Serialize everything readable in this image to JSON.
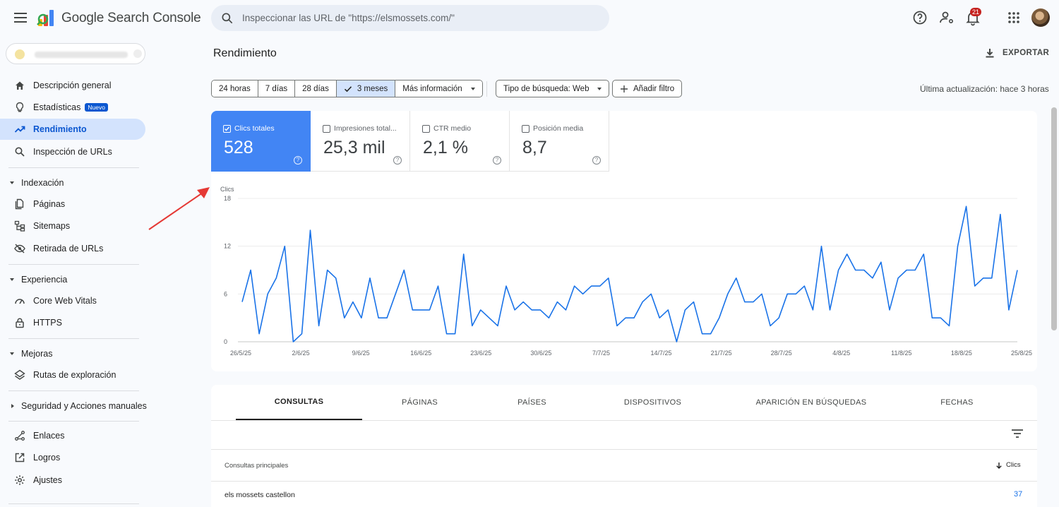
{
  "app": {
    "title": "Google Search Console",
    "search_placeholder": "Inspeccionar las URL de \"https://elsmossets.com/\"",
    "notifications_count": "21"
  },
  "sidebar": {
    "items_top": [
      {
        "label": "Descripción general",
        "icon": "home-icon"
      },
      {
        "label": "Estadísticas",
        "icon": "lightbulb-icon",
        "badge": "Nuevo"
      },
      {
        "label": "Rendimiento",
        "icon": "trending-up-icon",
        "active": true
      },
      {
        "label": "Inspección de URLs",
        "icon": "search-icon"
      }
    ],
    "sections": {
      "indexacion": "Indexación",
      "experiencia": "Experiencia",
      "mejoras": "Mejoras",
      "seguridad": "Seguridad y Acciones manuales"
    },
    "indexacion_items": [
      {
        "label": "Páginas"
      },
      {
        "label": "Sitemaps"
      },
      {
        "label": "Retirada de URLs"
      }
    ],
    "experiencia_items": [
      {
        "label": "Core Web Vitals"
      },
      {
        "label": "HTTPS"
      }
    ],
    "mejoras_items": [
      {
        "label": "Rutas de exploración"
      }
    ],
    "bottom_items": [
      {
        "label": "Enlaces"
      },
      {
        "label": "Logros"
      },
      {
        "label": "Ajustes"
      }
    ]
  },
  "main": {
    "title": "Rendimiento",
    "export_label": "EXPORTAR",
    "ranges": [
      "24 horas",
      "7 días",
      "28 días",
      "3 meses",
      "Más información"
    ],
    "active_range": "3 meses",
    "search_type": "Tipo de búsqueda: Web",
    "add_filter": "Añadir filtro",
    "last_update": "Última actualización: hace 3 horas",
    "metrics": [
      {
        "label": "Clics totales",
        "value": "528",
        "checked": true
      },
      {
        "label": "Impresiones total...",
        "value": "25,3 mil",
        "checked": false
      },
      {
        "label": "CTR medio",
        "value": "2,1 %",
        "checked": false
      },
      {
        "label": "Posición media",
        "value": "8,7",
        "checked": false
      }
    ],
    "tabs": [
      "CONSULTAS",
      "PÁGINAS",
      "PAÍSES",
      "DISPOSITIVOS",
      "APARICIÓN EN BÚSQUEDAS",
      "FECHAS"
    ],
    "table": {
      "col_left": "Consultas principales",
      "col_right": "Clics",
      "rows": [
        {
          "query": "els mossets castellon",
          "clicks": "37"
        }
      ]
    }
  },
  "chart_data": {
    "type": "line",
    "ylabel": "Clics",
    "ylim": [
      0,
      18
    ],
    "yticks": [
      0,
      6,
      12,
      18
    ],
    "x_tick_labels": [
      "26/5/25",
      "2/6/25",
      "9/6/25",
      "16/6/25",
      "23/6/25",
      "30/6/25",
      "7/7/25",
      "14/7/25",
      "21/7/25",
      "28/7/25",
      "4/8/25",
      "11/8/25",
      "18/8/25",
      "25/8/25"
    ],
    "grid": true,
    "color": "#1a73e8",
    "series": [
      {
        "values": [
          5,
          9,
          1,
          6,
          8,
          12,
          0,
          1,
          14,
          2,
          9,
          8,
          3,
          5,
          3,
          8,
          3,
          3,
          6,
          9,
          4,
          4,
          4,
          7,
          1,
          1,
          11,
          2,
          4,
          3,
          2,
          7,
          4,
          5,
          4,
          4,
          3,
          5,
          4,
          7,
          6,
          7,
          7,
          8,
          2,
          3,
          3,
          5,
          6,
          3,
          4,
          0,
          4,
          5,
          1,
          1,
          3,
          6,
          8,
          5,
          5,
          6,
          2,
          3,
          6,
          6,
          7,
          4,
          12,
          4,
          9,
          11,
          9,
          9,
          8,
          10,
          4,
          8,
          9,
          9,
          11,
          3,
          3,
          2,
          12,
          17,
          7,
          8,
          8,
          16,
          4,
          9
        ]
      }
    ]
  }
}
